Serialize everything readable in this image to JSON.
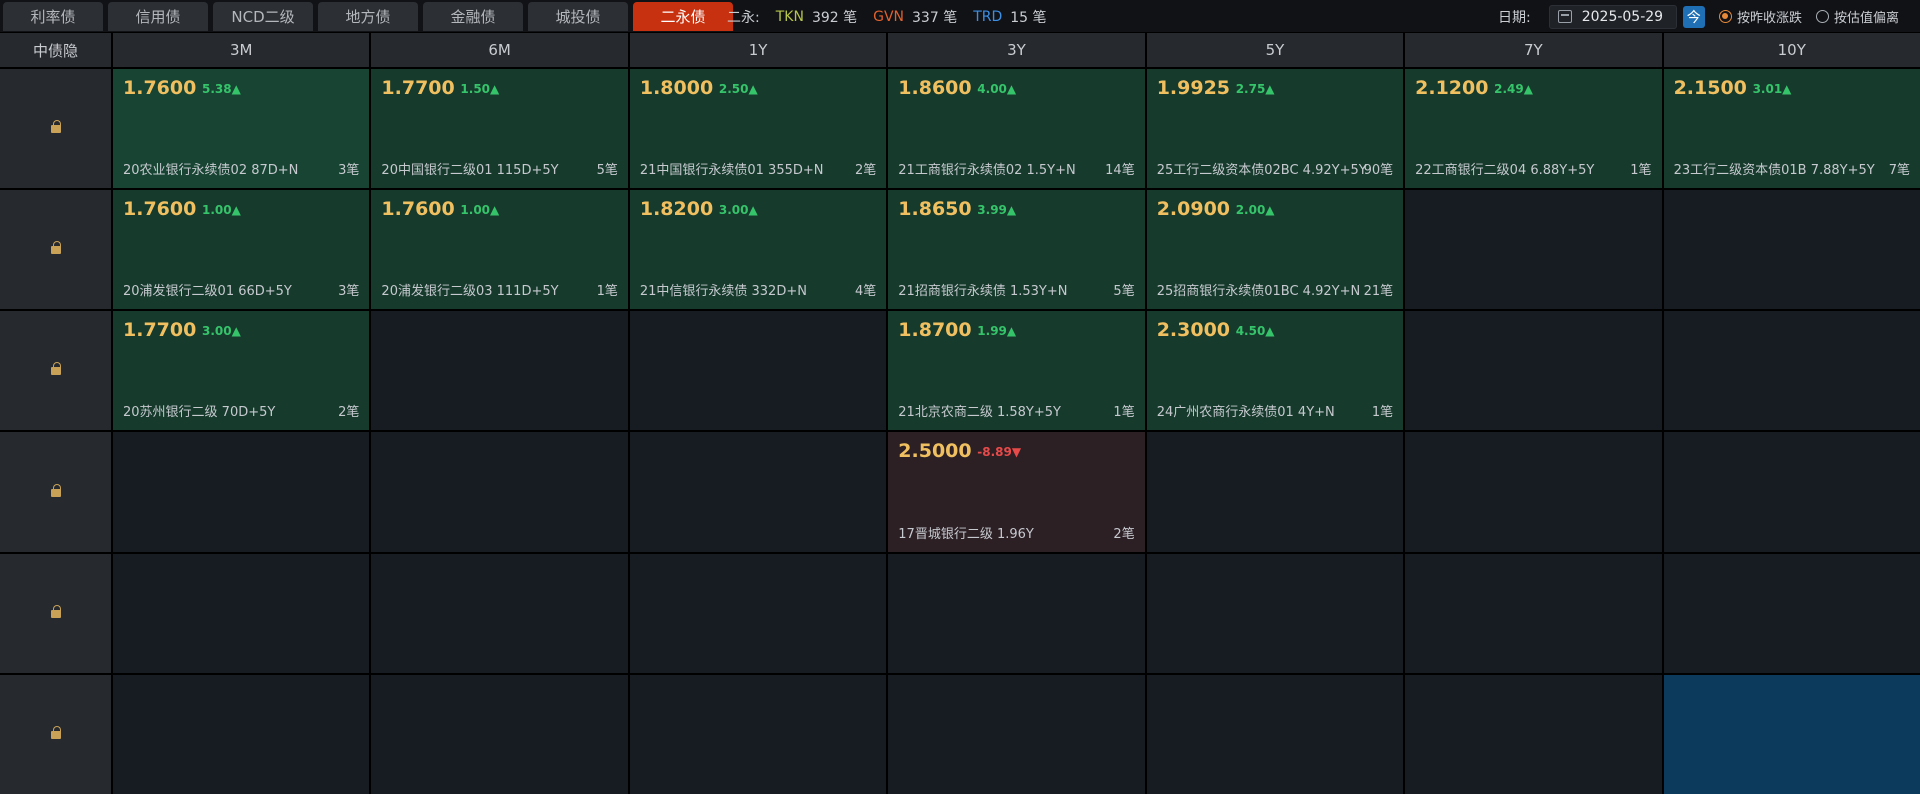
{
  "tabs": [
    {
      "label": "利率债",
      "active": false
    },
    {
      "label": "信用债",
      "active": false
    },
    {
      "label": "NCD二级",
      "active": false
    },
    {
      "label": "地方债",
      "active": false
    },
    {
      "label": "金融债",
      "active": false
    },
    {
      "label": "城投债",
      "active": false
    },
    {
      "label": "二永债",
      "active": true
    }
  ],
  "summary": {
    "label": "二永:",
    "tkn_tag": "TKN",
    "tkn_count": "392 笔",
    "gvn_tag": "GVN",
    "gvn_count": "337 笔",
    "trd_tag": "TRD",
    "trd_count": "15 笔"
  },
  "date": {
    "label": "日期:",
    "value": "2025-05-29",
    "today_label": "今"
  },
  "radios": [
    {
      "label": "按昨收涨跌",
      "checked": true
    },
    {
      "label": "按估值偏离",
      "checked": false
    }
  ],
  "grid": {
    "corner_label": "中债隐",
    "columns": [
      "3M",
      "6M",
      "1Y",
      "3Y",
      "5Y",
      "7Y",
      "10Y"
    ],
    "rows": [
      [
        {
          "price": "1.7600",
          "change": "5.38▲",
          "name": "20农业银行永续债02 87D+N",
          "trades": "3笔",
          "dir": "up"
        },
        {
          "price": "1.7700",
          "change": "1.50▲",
          "name": "20中国银行二级01 115D+5Y",
          "trades": "5笔",
          "dir": "up"
        },
        {
          "price": "1.8000",
          "change": "2.50▲",
          "name": "21中国银行永续债01 355D+N",
          "trades": "2笔",
          "dir": "up"
        },
        {
          "price": "1.8600",
          "change": "4.00▲",
          "name": "21工商银行永续债02 1.5Y+N",
          "trades": "14笔",
          "dir": "up"
        },
        {
          "price": "1.9925",
          "change": "2.75▲",
          "name": "25工行二级资本债02BC 4.92Y+5Y",
          "trades": "90笔",
          "dir": "up"
        },
        {
          "price": "2.1200",
          "change": "2.49▲",
          "name": "22工商银行二级04 6.88Y+5Y",
          "trades": "1笔",
          "dir": "up"
        },
        {
          "price": "2.1500",
          "change": "3.01▲",
          "name": "23工行二级资本债01B 7.88Y+5Y",
          "trades": "7笔",
          "dir": "up"
        }
      ],
      [
        {
          "price": "1.7600",
          "change": "1.00▲",
          "name": "20浦发银行二级01 66D+5Y",
          "trades": "3笔",
          "dir": "up"
        },
        {
          "price": "1.7600",
          "change": "1.00▲",
          "name": "20浦发银行二级03 111D+5Y",
          "trades": "1笔",
          "dir": "up"
        },
        {
          "price": "1.8200",
          "change": "3.00▲",
          "name": "21中信银行永续债 332D+N",
          "trades": "4笔",
          "dir": "up"
        },
        {
          "price": "1.8650",
          "change": "3.99▲",
          "name": "21招商银行永续债 1.53Y+N",
          "trades": "5笔",
          "dir": "up"
        },
        {
          "price": "2.0900",
          "change": "2.00▲",
          "name": "25招商银行永续债01BC 4.92Y+N",
          "trades": "21笔",
          "dir": "up"
        },
        null,
        null
      ],
      [
        {
          "price": "1.7700",
          "change": "3.00▲",
          "name": "20苏州银行二级 70D+5Y",
          "trades": "2笔",
          "dir": "up"
        },
        null,
        null,
        {
          "price": "1.8700",
          "change": "1.99▲",
          "name": "21北京农商二级 1.58Y+5Y",
          "trades": "1笔",
          "dir": "up"
        },
        {
          "price": "2.3000",
          "change": "4.50▲",
          "name": "24广州农商行永续债01 4Y+N",
          "trades": "1笔",
          "dir": "up"
        },
        null,
        null
      ],
      [
        null,
        null,
        null,
        {
          "price": "2.5000",
          "change": "-8.89▼",
          "name": "17晋城银行二级 1.96Y",
          "trades": "2笔",
          "dir": "down"
        },
        null,
        null,
        null
      ],
      [
        null,
        null,
        null,
        null,
        null,
        null,
        null
      ],
      [
        null,
        null,
        null,
        null,
        null,
        null,
        "selected"
      ]
    ]
  },
  "colors": {
    "active_tab": "#c7310f",
    "price": "#f0c060",
    "up": "#36c46b",
    "down": "#e84a4a",
    "up_cell": "#163a2c",
    "down_cell": "#2c2025",
    "selected_cell": "#0c3a5c"
  }
}
